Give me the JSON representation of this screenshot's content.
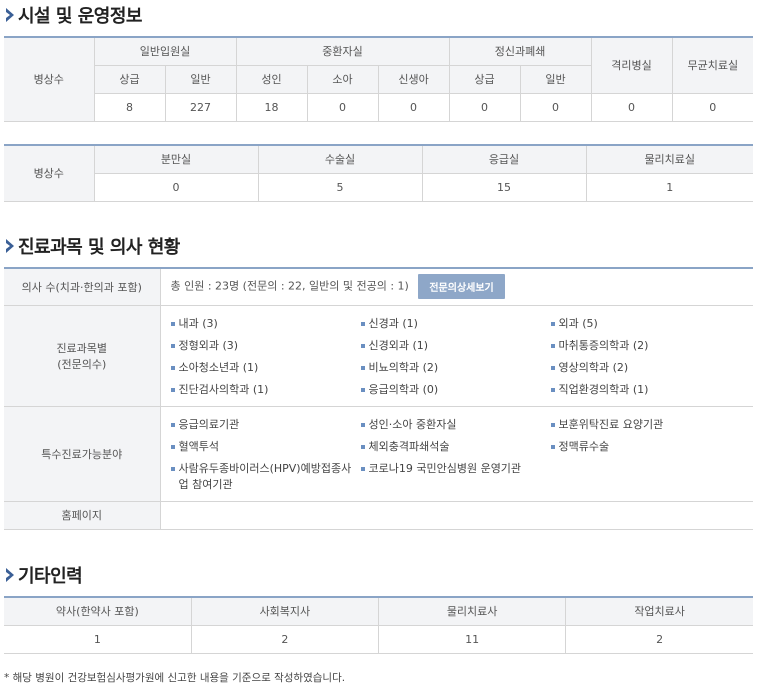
{
  "sections": {
    "facility": "시설 및 운영정보",
    "doctors": "진료과목 및 의사 현황",
    "staff": "기타인력"
  },
  "beds1": {
    "row_label": "병상수",
    "groups": [
      "일반입원실",
      "중환자실",
      "정신과폐쇄",
      "격리병실",
      "무균치료실"
    ],
    "subs": [
      "상급",
      "일반",
      "성인",
      "소아",
      "신생아",
      "상급",
      "일반"
    ],
    "values": [
      "8",
      "227",
      "18",
      "0",
      "0",
      "0",
      "0",
      "0",
      "0"
    ]
  },
  "beds2": {
    "row_label": "병상수",
    "headers": [
      "분만실",
      "수술실",
      "응급실",
      "물리치료실"
    ],
    "values": [
      "0",
      "5",
      "15",
      "1"
    ]
  },
  "doctors": {
    "count_label": "의사 수(치과·한의과 포함)",
    "count_value": "총 인원 : 23명 (전문의 : 22, 일반의 및 전공의 : 1)",
    "detail_button": "전문의상세보기",
    "dept_label_1": "진료과목별",
    "dept_label_2": "(전문의수)",
    "depts": [
      "내과 (3)",
      "신경과 (1)",
      "외과 (5)",
      "정형외과 (3)",
      "신경외과 (1)",
      "마취통증의학과 (2)",
      "소아청소년과 (1)",
      "비뇨의학과 (2)",
      "영상의학과 (2)",
      "진단검사의학과 (1)",
      "응급의학과 (0)",
      "직업환경의학과 (1)"
    ],
    "special_label": "특수진료가능분야",
    "specials": [
      "응급의료기관",
      "성인·소아 중환자실",
      "보훈위탁진료 요양기관",
      "혈액투석",
      "체외충격파쇄석술",
      "정맥류수술",
      "사람유두종바이러스(HPV)예방접종사업 참여기관",
      "코로나19 국민안심병원 운영기관"
    ],
    "homepage_label": "홈페이지",
    "homepage_value": ""
  },
  "staff": {
    "headers": [
      "약사(한약사 포함)",
      "사회복지사",
      "물리치료사",
      "작업치료사"
    ],
    "values": [
      "1",
      "2",
      "11",
      "2"
    ]
  },
  "footnote": "* 해당 병원이 건강보험심사평가원에 신고한 내용을 기준으로 작성하였습니다."
}
